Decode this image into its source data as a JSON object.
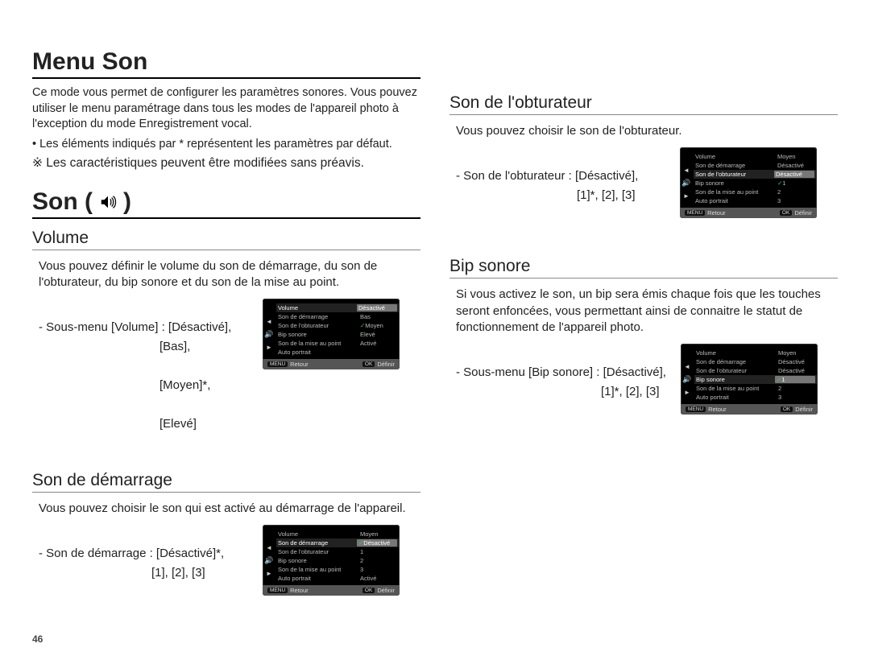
{
  "page_number": "46",
  "title_menu": "Menu Son",
  "intro": "Ce mode vous permet de configurer les paramètres sonores. Vous pouvez utiliser le menu paramétrage dans tous les modes de l'appareil photo à l'exception du mode Enregistrement vocal.",
  "bullet_default": "Les éléments indiqués par * représentent les paramètres par défaut.",
  "note_spec": "※ Les caractéristiques peuvent être modifiées sans préavis.",
  "son_title": "Son (",
  "son_title_close": ")",
  "volume": {
    "heading": "Volume",
    "desc": "Vous pouvez définir le volume du son de démarrage, du son de l'obturateur, du bip sonore et du son de la mise au point.",
    "optline": "-  Sous-menu [Volume] : [Désactivé],",
    "opt2": "[Bas],",
    "opt3": "[Moyen]*,",
    "opt4": "[Elevé]"
  },
  "demarrage": {
    "heading": "Son de démarrage",
    "desc": "Vous pouvez choisir le son qui est activé au démarrage de l'appareil.",
    "optline": "- Son de démarrage : [Désactivé]*,",
    "opt2": "[1], [2], [3]"
  },
  "obturateur": {
    "heading": "Son de l'obturateur",
    "desc": "Vous pouvez choisir le son de l'obturateur.",
    "optline": "- Son de l'obturateur : [Désactivé],",
    "opt2": "[1]*, [2], [3]"
  },
  "bip": {
    "heading": "Bip sonore",
    "desc": "Si vous activez le son, un bip sera émis chaque fois que les touches seront enfoncées, vous permettant ainsi de connaitre le statut de fonctionnement de l'appareil photo.",
    "optline": "- Sous-menu [Bip sonore] : [Désactivé],",
    "opt2": "[1]*, [2], [3]"
  },
  "lcd": {
    "rows": {
      "volume": "Volume",
      "demarrage": "Son de démarrage",
      "obturateur": "Son de l'obturateur",
      "bip": "Bip sonore",
      "map": "Son de la mise au point",
      "auto": "Auto portrait"
    },
    "vals": {
      "moyen": "Moyen",
      "desactive": "Désactivé",
      "bas": "Bas",
      "eleve": "Elevé",
      "active": "Activé",
      "un": "1",
      "deux": "2",
      "trois": "3"
    },
    "footer": {
      "retour": "Retour",
      "definir": "Définir",
      "menu": "MENU",
      "ok": "OK"
    }
  }
}
